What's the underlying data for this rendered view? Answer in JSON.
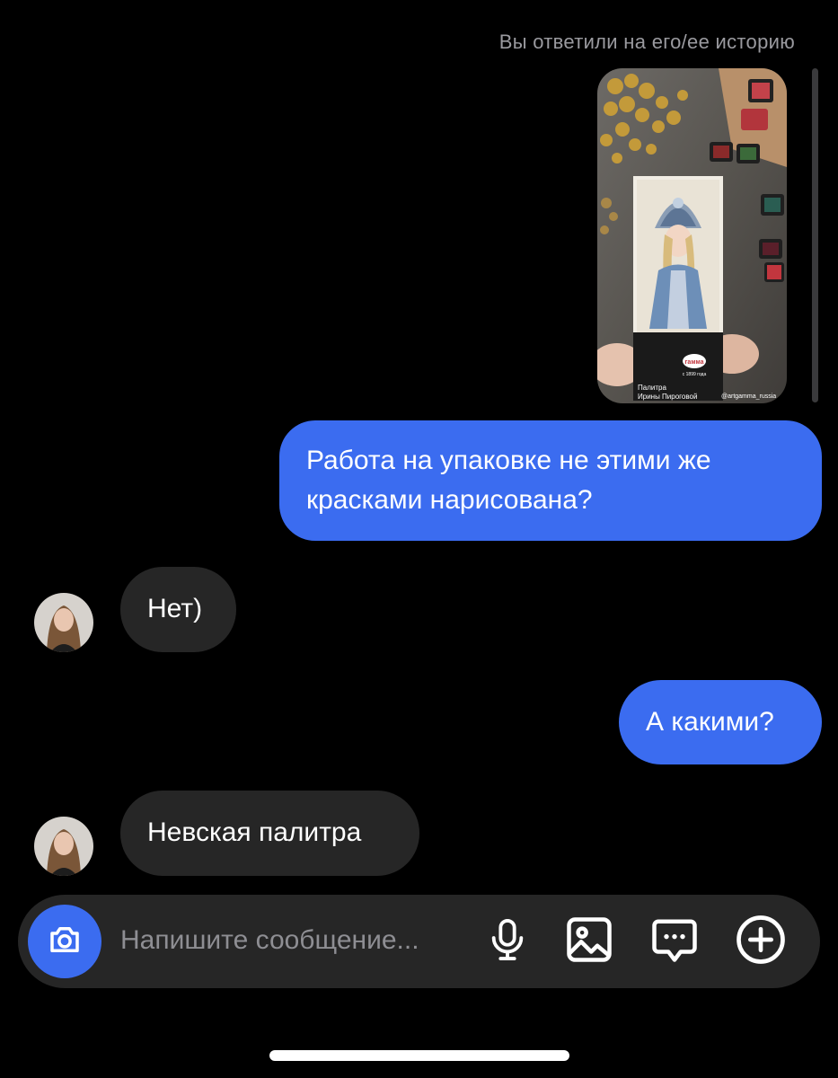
{
  "story_reply": {
    "caption": "Вы ответили на его/ее историю",
    "package": {
      "brand": "гамма",
      "since": "с 1899 года",
      "line1": "Палитра",
      "line2": "Ирины Пироговой",
      "handle": "@artgamma_russia"
    }
  },
  "messages": [
    {
      "direction": "outgoing",
      "text": "Работа на упаковке не этими же красками нарисована?"
    },
    {
      "direction": "incoming",
      "text": "Нет)"
    },
    {
      "direction": "outgoing",
      "text": "А какими?"
    },
    {
      "direction": "incoming",
      "text": "Невская палитра"
    }
  ],
  "composer": {
    "placeholder": "Напишите сообщение...",
    "icons": [
      "camera-icon",
      "microphone-icon",
      "gallery-icon",
      "sticker-icon",
      "plus-icon"
    ]
  },
  "colors": {
    "background": "#000000",
    "outgoing_bubble": "#3b6cf0",
    "incoming_bubble": "#262626",
    "composer": "#262626"
  }
}
